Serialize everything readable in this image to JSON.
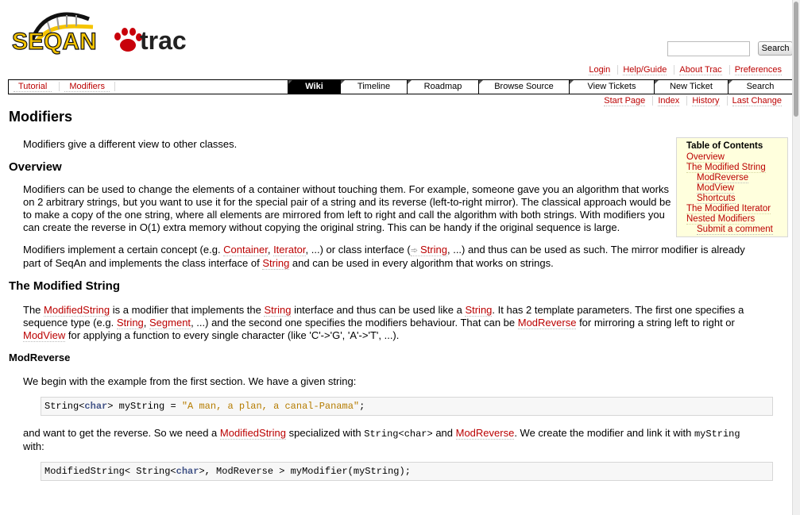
{
  "logo": {
    "left_text": "SEQAN",
    "right_text": "trac"
  },
  "search": {
    "placeholder": "",
    "button": "Search"
  },
  "metanav": [
    "Login",
    "Help/Guide",
    "About Trac",
    "Preferences"
  ],
  "localnav": [
    "Tutorial",
    "Modifiers"
  ],
  "mainnav": [
    "Wiki",
    "Timeline",
    "Roadmap",
    "Browse Source",
    "View Tickets",
    "New Ticket",
    "Search"
  ],
  "ctxtnav": [
    "Start Page",
    "Index",
    "History",
    "Last Change"
  ],
  "page": {
    "title": "Modifiers",
    "intro": "Modifiers give a different view to other classes.",
    "overview_heading": "Overview",
    "overview_p1": "Modifiers can be used to change the elements of a container without touching them. For example, someone gave you an algorithm that works on 2 arbitrary strings, but you want to use it for the special pair of a string and its reverse (left-to-right mirror). The classical approach would be to make a copy of the one string, where all elements are mirrored from left to right and call the algorithm with both strings. With modifiers you can create the reverse in O(1) extra memory without copying the original string. This can be handy if the original sequence is large.",
    "p2": {
      "t1": "Modifiers implement a certain concept (e.g. ",
      "l1": "Container",
      "t2": ", ",
      "l2": "Iterator",
      "t3": ", ...) or class interface (",
      "l3": "String",
      "t4": ", ...) and thus can be used as such. The mirror modifier is already part of SeqAn and implements the class interface of ",
      "l4": "String",
      "t5": " and can be used in every algorithm that works on strings."
    },
    "modstring_heading": "The Modified String",
    "p3": {
      "t1": "The ",
      "l1": "ModifiedString",
      "t2": " is a modifier that implements the ",
      "l2": "String",
      "t3": " interface and thus can be used like a ",
      "l3": "String",
      "t4": ". It has 2 template parameters. The first one specifies a sequence type (e.g. ",
      "l4": "String",
      "t5": ", ",
      "l5": "Segment",
      "t6": ", ...) and the second one specifies the modifiers behaviour. That can be ",
      "l6": "ModReverse",
      "t7": " for mirroring a string left to right or ",
      "l7": "ModView",
      "t8": " for applying a function to every single character (like 'C'->'G', 'A'->'T', ...)."
    },
    "modreverse_heading": "ModReverse",
    "p4": "We begin with the example from the first section. We have a given string:",
    "code1": {
      "a": "String<",
      "kw": "char",
      "b": "> myString = ",
      "str": "\"A man, a plan, a canal-Panama\"",
      "c": ";"
    },
    "p5": {
      "t1": "and want to get the reverse. So we need a ",
      "l1": "ModifiedString",
      "t2": " specialized with ",
      "c1": "String<char>",
      "t3": " and ",
      "l2": "ModReverse",
      "t4": ". We create the modifier and link it with ",
      "c2": "myString",
      "t5": " with:"
    },
    "code2": {
      "a": "ModifiedString< String<",
      "kw": "char",
      "b": ">, ModReverse > myModifier(myString);"
    }
  },
  "toc": {
    "title": "Table of Contents",
    "items": [
      {
        "label": "Overview",
        "level": 1
      },
      {
        "label": "The Modified String",
        "level": 1
      },
      {
        "label": "ModReverse",
        "level": 2
      },
      {
        "label": "ModView",
        "level": 2
      },
      {
        "label": "Shortcuts",
        "level": 2
      },
      {
        "label": "The Modified Iterator",
        "level": 1
      },
      {
        "label": "Nested Modifiers",
        "level": 1
      },
      {
        "label": "Submit a comment",
        "level": 2
      }
    ]
  },
  "colors": {
    "link": "#bb0000",
    "toc_bg": "#ffffdd",
    "code_bg": "#f7f7f7",
    "logo_yellow": "#f5c400",
    "logo_red": "#c8000a"
  }
}
